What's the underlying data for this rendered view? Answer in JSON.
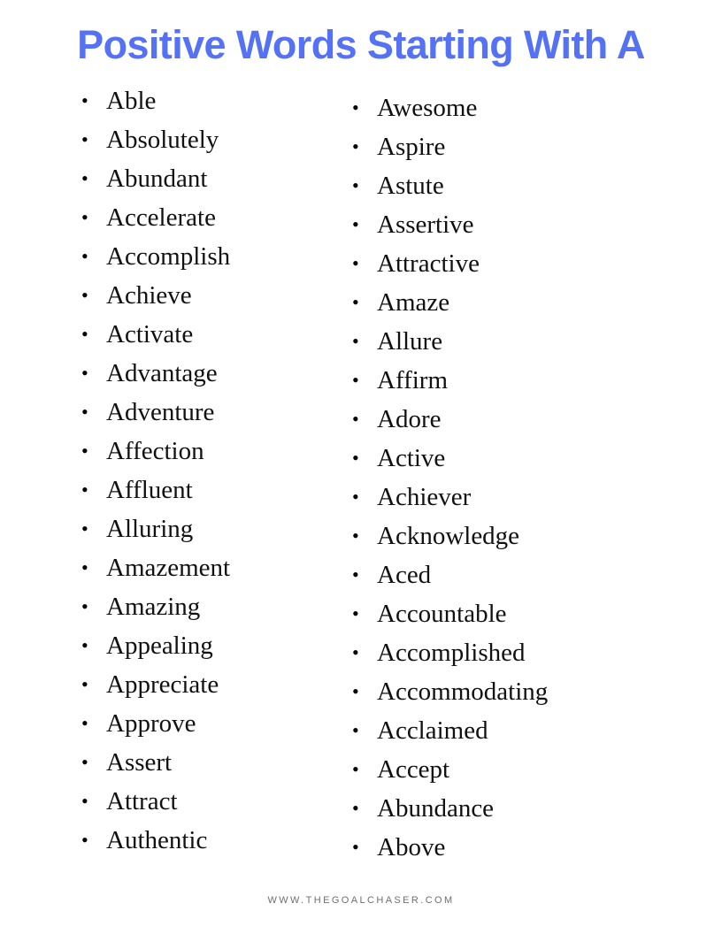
{
  "title": "Positive Words Starting With A",
  "theme": {
    "title_color": "#5572F5",
    "text_color": "#111111",
    "background": "#FFFFFF",
    "footer_color": "#6F6F6F"
  },
  "bullet_glyph": "•",
  "columns": [
    {
      "name": "left-column",
      "items": [
        "Able",
        "Absolutely",
        "Abundant",
        "Accelerate",
        "Accomplish",
        "Achieve",
        "Activate",
        "Advantage",
        "Adventure",
        "Affection",
        "Affluent",
        "Alluring",
        "Amazement",
        "Amazing",
        "Appealing",
        "Appreciate",
        "Approve",
        "Assert",
        "Attract",
        "Authentic"
      ]
    },
    {
      "name": "right-column",
      "items": [
        "Awesome",
        "Aspire",
        "Astute",
        "Assertive",
        "Attractive",
        "Amaze",
        "Allure",
        "Affirm",
        "Adore",
        "Active",
        "Achiever",
        "Acknowledge",
        "Aced",
        "Accountable",
        "Accomplished",
        "Accommodating",
        "Acclaimed",
        "Accept",
        "Abundance",
        "Above"
      ]
    }
  ],
  "footer": {
    "website": "WWW.THEGOALCHASER.COM"
  }
}
